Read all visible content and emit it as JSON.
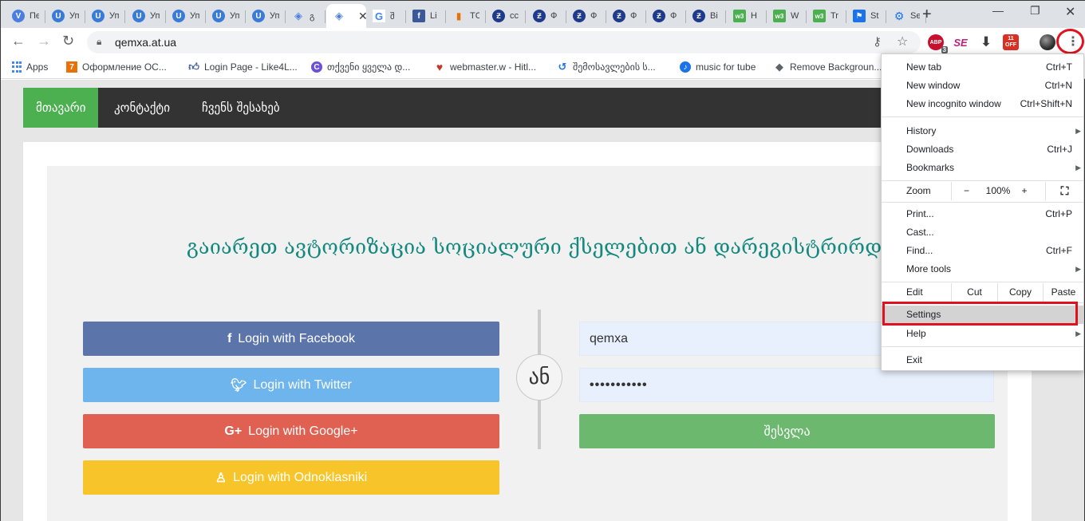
{
  "browser": {
    "tabs": [
      {
        "icon": "vpn-icon",
        "glyph": "V",
        "title": "Пе"
      },
      {
        "icon": "ucoz-icon",
        "glyph": "U",
        "title": "Уп"
      },
      {
        "icon": "ucoz-icon",
        "glyph": "U",
        "title": "Уп"
      },
      {
        "icon": "ucoz-icon",
        "glyph": "U",
        "title": "Уп"
      },
      {
        "icon": "ucoz-icon",
        "glyph": "U",
        "title": "Уп"
      },
      {
        "icon": "ucoz-icon",
        "glyph": "U",
        "title": "Уп"
      },
      {
        "icon": "ucoz-icon",
        "glyph": "U",
        "title": "Уп"
      },
      {
        "icon": "diamond-icon",
        "glyph": "◈",
        "title": "გ"
      },
      {
        "icon": "diamond-icon",
        "glyph": "◈",
        "title": "",
        "active": true
      },
      {
        "icon": "google-icon",
        "glyph": "G",
        "title": "შ"
      },
      {
        "icon": "facebook-icon",
        "glyph": "f",
        "title": "Li"
      },
      {
        "icon": "chart-bars-icon",
        "glyph": "▮",
        "title": "TC"
      },
      {
        "icon": "zeta-icon",
        "glyph": "Ƶ",
        "title": "cc"
      },
      {
        "icon": "zeta-icon",
        "glyph": "Ƶ",
        "title": "Ф"
      },
      {
        "icon": "zeta-icon",
        "glyph": "Ƶ",
        "title": "Ф"
      },
      {
        "icon": "zeta-icon",
        "glyph": "Ƶ",
        "title": "Ф"
      },
      {
        "icon": "zeta-icon",
        "glyph": "Ƶ",
        "title": "Ф"
      },
      {
        "icon": "zeta-icon",
        "glyph": "Ƶ",
        "title": "Вi"
      },
      {
        "icon": "w3-icon",
        "glyph": "w3",
        "title": "Н"
      },
      {
        "icon": "w3-icon",
        "glyph": "w3",
        "title": "W"
      },
      {
        "icon": "w3-icon",
        "glyph": "w3",
        "title": "Tr"
      },
      {
        "icon": "flag-icon",
        "glyph": "⚑",
        "title": "St"
      },
      {
        "icon": "gear-icon",
        "glyph": "⚙",
        "title": "Se"
      }
    ],
    "url": "qemxa.at.ua",
    "bookmarks": [
      {
        "label": "Apps"
      },
      {
        "label": "Оформление ОС..."
      },
      {
        "label": "Login Page - Like4L..."
      },
      {
        "label": "თქვენი ყველა დ..."
      },
      {
        "label": "webmaster.w - Hitl..."
      },
      {
        "label": "შემოსავლების ს..."
      },
      {
        "label": "music for tube"
      },
      {
        "label": "Remove Backgroun..."
      }
    ],
    "extensions": {
      "abp_badge": "3",
      "off_label": "OFF",
      "off_top": "11"
    }
  },
  "site": {
    "nav": [
      "მთავარი",
      "კონტაქტი",
      "ჩვენს შესახებ"
    ],
    "heading": "გაიარეთ ავტორიზაცია სოციალური ქსელებით ან დარეგისტრირდით",
    "buttons": {
      "facebook": "Login with Facebook",
      "twitter": "Login with Twitter",
      "google": "Login with Google+",
      "odnoklassniki": "Login with Odnoklasniki"
    },
    "or_label": "ან",
    "username_value": "qemxa",
    "password_value": "•••••••••••",
    "submit_label": "შესვლა"
  },
  "menu": {
    "new_tab": {
      "label": "New tab",
      "shortcut": "Ctrl+T"
    },
    "new_window": {
      "label": "New window",
      "shortcut": "Ctrl+N"
    },
    "incognito": {
      "label": "New incognito window",
      "shortcut": "Ctrl+Shift+N"
    },
    "history": {
      "label": "History"
    },
    "downloads": {
      "label": "Downloads",
      "shortcut": "Ctrl+J"
    },
    "bookmarks": {
      "label": "Bookmarks"
    },
    "zoom": {
      "label": "Zoom",
      "minus": "−",
      "value": "100%",
      "plus": "+"
    },
    "print": {
      "label": "Print...",
      "shortcut": "Ctrl+P"
    },
    "cast": {
      "label": "Cast..."
    },
    "find": {
      "label": "Find...",
      "shortcut": "Ctrl+F"
    },
    "more_tools": {
      "label": "More tools"
    },
    "edit": {
      "label": "Edit",
      "cut": "Cut",
      "copy": "Copy",
      "paste": "Paste"
    },
    "settings": {
      "label": "Settings"
    },
    "help": {
      "label": "Help"
    },
    "exit": {
      "label": "Exit"
    }
  },
  "colors": {
    "highlight": "#e0121d",
    "nav_active": "#4caf50",
    "heading": "#16897e"
  }
}
